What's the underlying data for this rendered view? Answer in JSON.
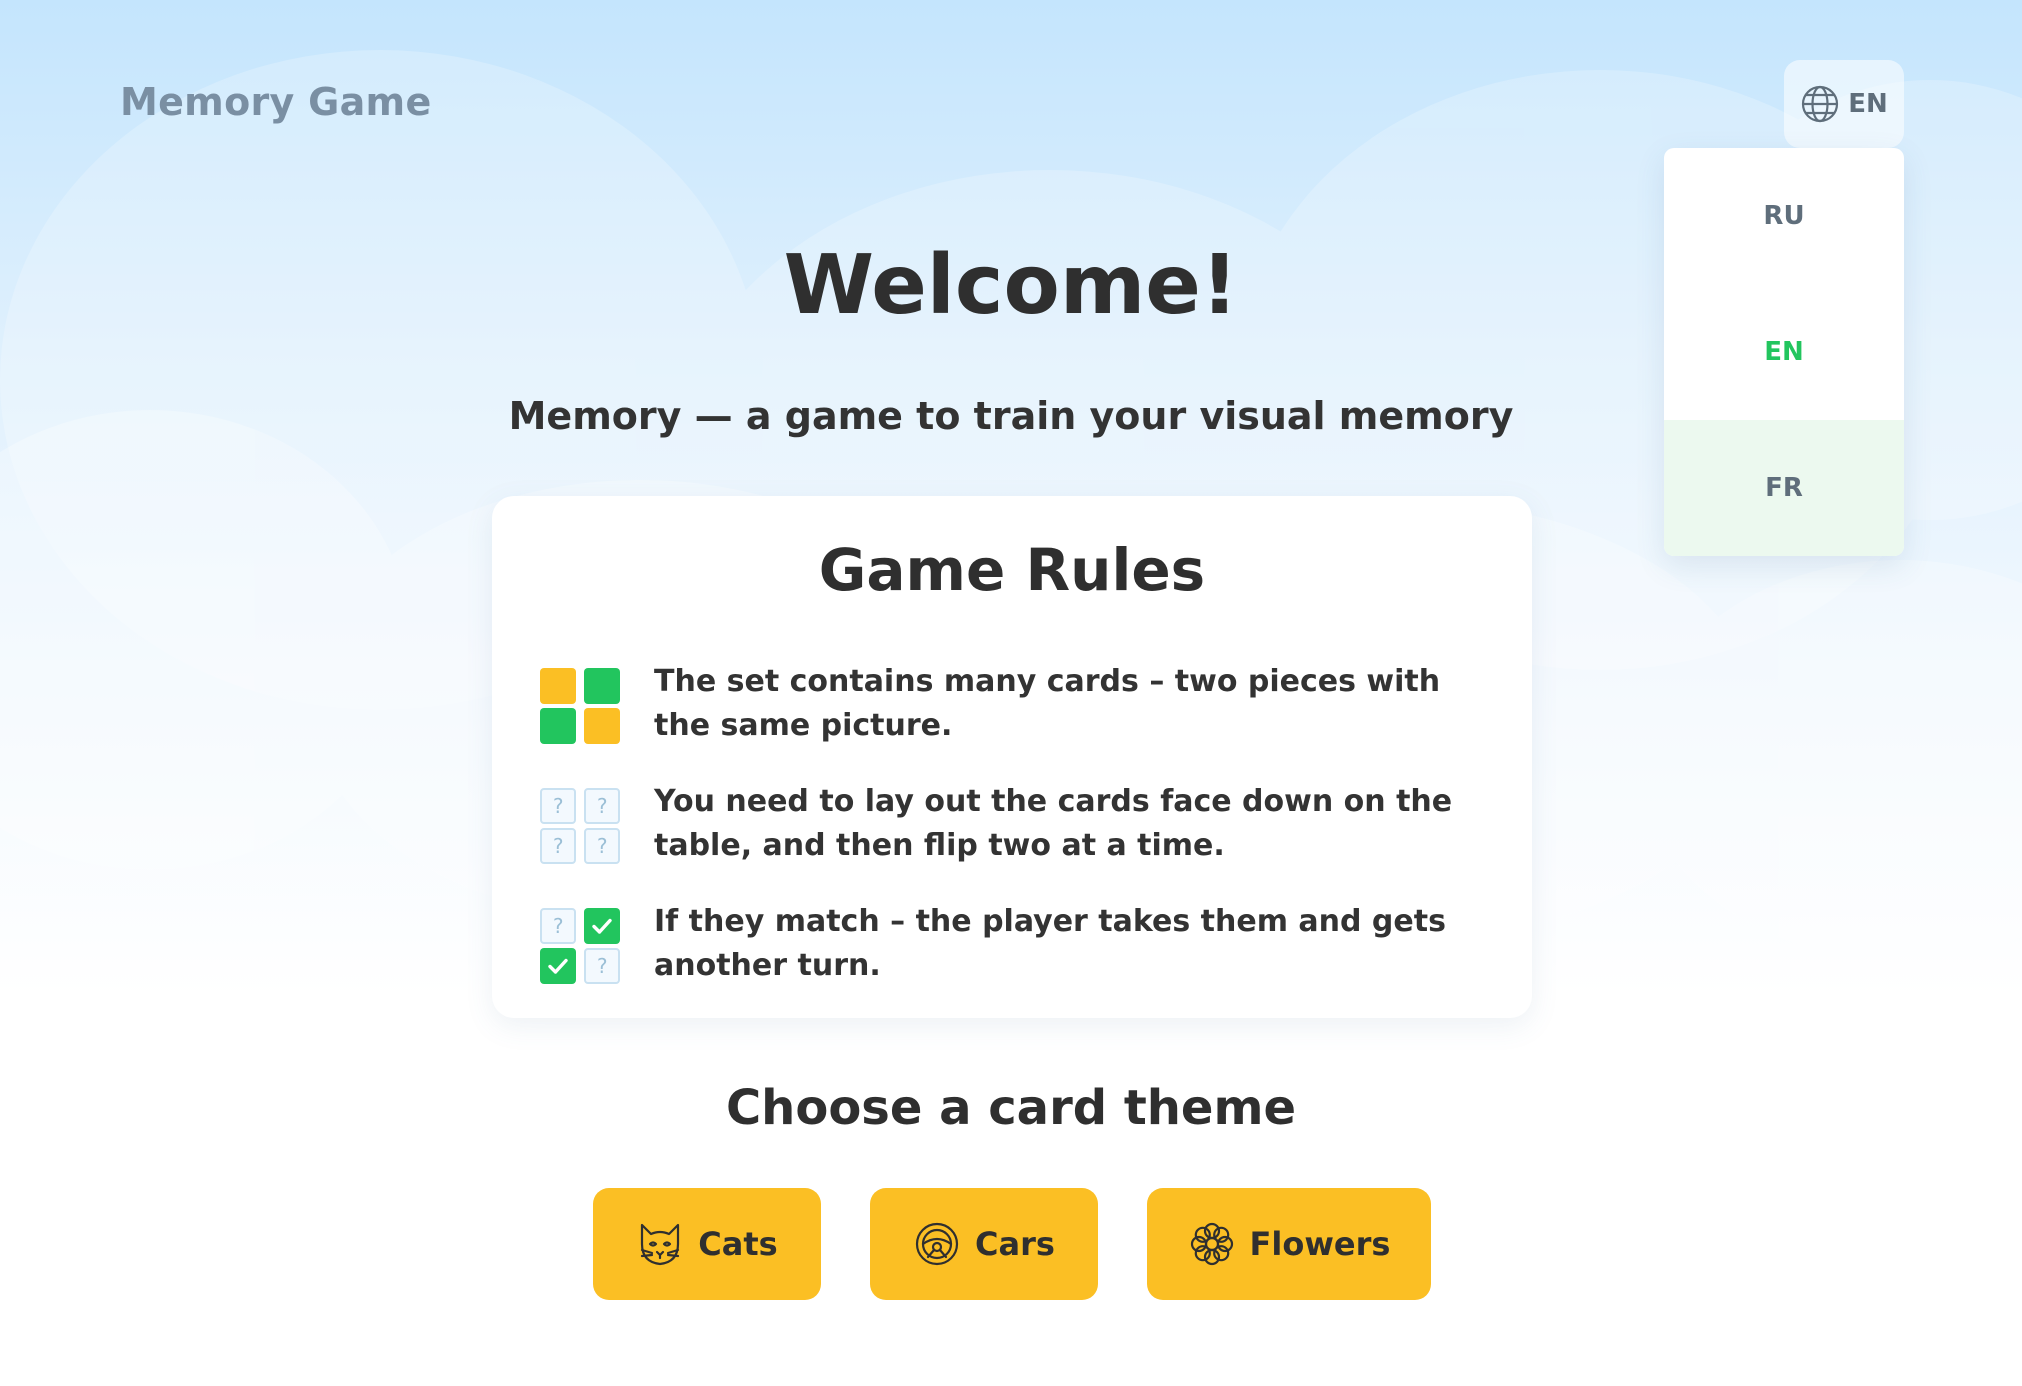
{
  "header": {
    "logo": "Memory Game",
    "language": {
      "current": "EN",
      "icon": "globe-icon"
    }
  },
  "language_menu": {
    "items": [
      {
        "code": "RU",
        "state": "default"
      },
      {
        "code": "EN",
        "state": "selected"
      },
      {
        "code": "FR",
        "state": "hovered"
      }
    ]
  },
  "hero": {
    "title": "Welcome!",
    "subtitle": "Memory — a game to train your visual memory"
  },
  "rules": {
    "title": "Game Rules",
    "items": [
      {
        "icon": "colored-cards-icon",
        "text": "The set contains many cards – two pieces with the same picture."
      },
      {
        "icon": "face-down-cards-icon",
        "text": "You need to lay out the cards face down on the table, and then flip two at a time."
      },
      {
        "icon": "matched-cards-icon",
        "text": "If they match – the player takes them and gets another turn."
      }
    ],
    "card_back_glyph": "?"
  },
  "themes": {
    "title": "Choose a card theme",
    "buttons": [
      {
        "label": "Cats",
        "icon": "cat-icon"
      },
      {
        "label": "Cars",
        "icon": "steering-wheel-icon"
      },
      {
        "label": "Flowers",
        "icon": "flower-icon"
      }
    ]
  },
  "colors": {
    "accent_yellow": "#fbbf24",
    "accent_green": "#22c55e",
    "sky_top": "#c4e5fd",
    "text_dark": "#2f2f2f",
    "text_muted": "#5f6e7b"
  }
}
